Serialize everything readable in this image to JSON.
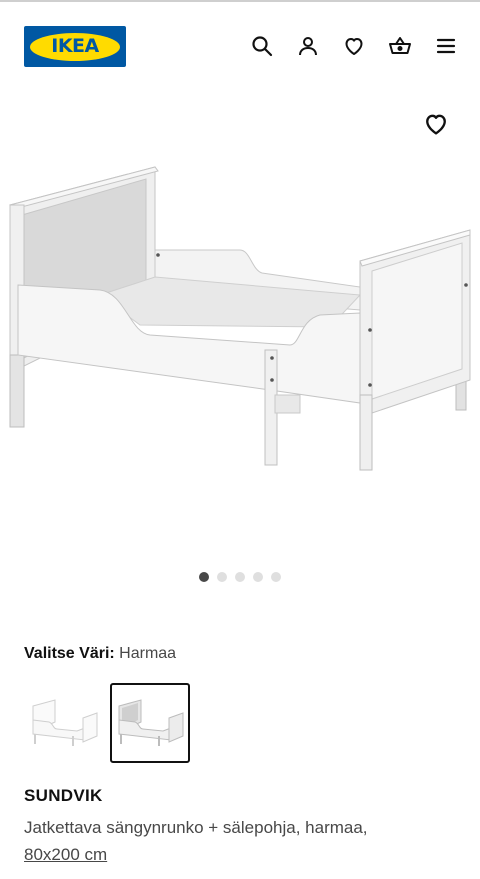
{
  "header": {
    "logo_text": "IKEA",
    "icons": [
      "search-icon",
      "user-icon",
      "heart-icon",
      "basket-icon",
      "menu-icon"
    ]
  },
  "gallery": {
    "dots_count": 5,
    "active_dot": 1
  },
  "color": {
    "label": "Valitse Väri:",
    "value": "Harmaa",
    "selected_swatch": 2
  },
  "product": {
    "name": "SUNDVIK",
    "description": "Jatkettava sängynrunko + sälepohja, harmaa,",
    "size": "80x200 cm"
  },
  "colors": {
    "brand_blue": "#0058a3",
    "brand_yellow": "#ffdb00",
    "text": "#111111",
    "muted": "#484848"
  }
}
